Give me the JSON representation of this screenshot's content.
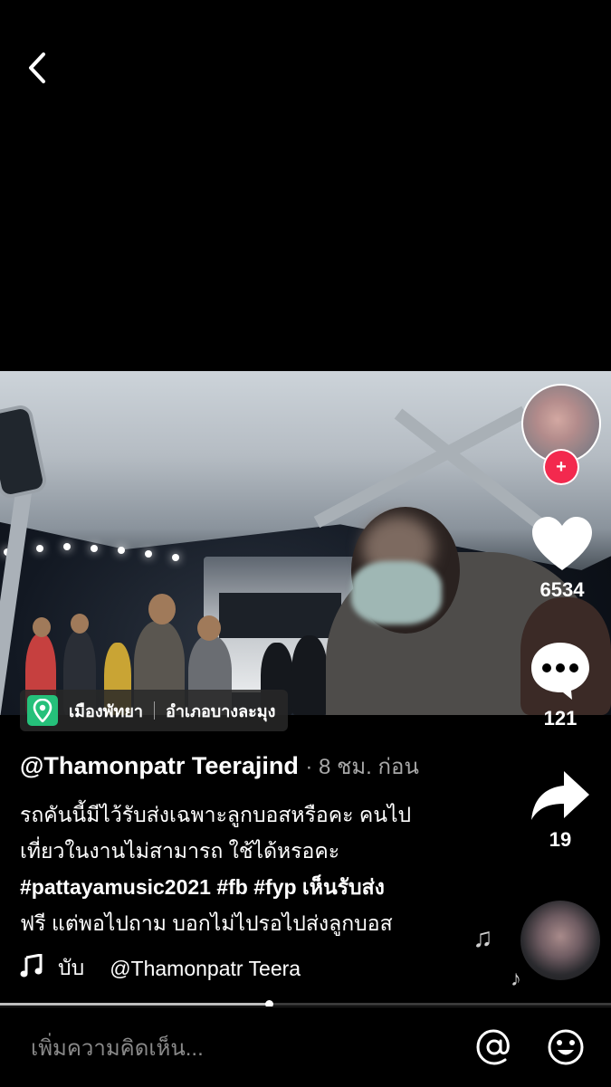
{
  "location": {
    "place": "เมืองพัทยา",
    "district": "อำเภอบางละมุง"
  },
  "author": {
    "handle": "@Thamonpatr Teerajind",
    "time": "· 8 ชม. ก่อน"
  },
  "description": {
    "line1": "รถคันนี้มีไว้รับส่งเฉพาะลูกบอสหรือคะ คนไป",
    "line2": "เที่ยวในงานไม่สามารถ ใช้ได้หรอคะ",
    "tags": "#pattayamusic2021 #fb #fyp",
    "line3_rest": " เห็นรับส่ง",
    "line4": "ฟรี แต่พอไปถาม บอกไม่ไปรอไปส่งลูกบอส"
  },
  "sound": {
    "title": "บับ",
    "artist": "@Thamonpatr Teera"
  },
  "stats": {
    "likes": "6534",
    "comments": "121",
    "shares": "19"
  },
  "comment": {
    "placeholder": "เพิ่มความคิดเห็น..."
  },
  "playback": {
    "progress": 0.44
  },
  "icons": {
    "back": "chevron-left-icon",
    "pin": "location-pin-icon",
    "like": "heart-icon",
    "comment": "comment-bubble-icon",
    "share": "share-arrow-icon",
    "music": "music-note-icon",
    "mention": "at-icon",
    "emoji": "emoji-icon",
    "follow": "plus-icon"
  },
  "colors": {
    "accent": "#f3294e",
    "location": "#25c07a",
    "background": "#000000"
  }
}
